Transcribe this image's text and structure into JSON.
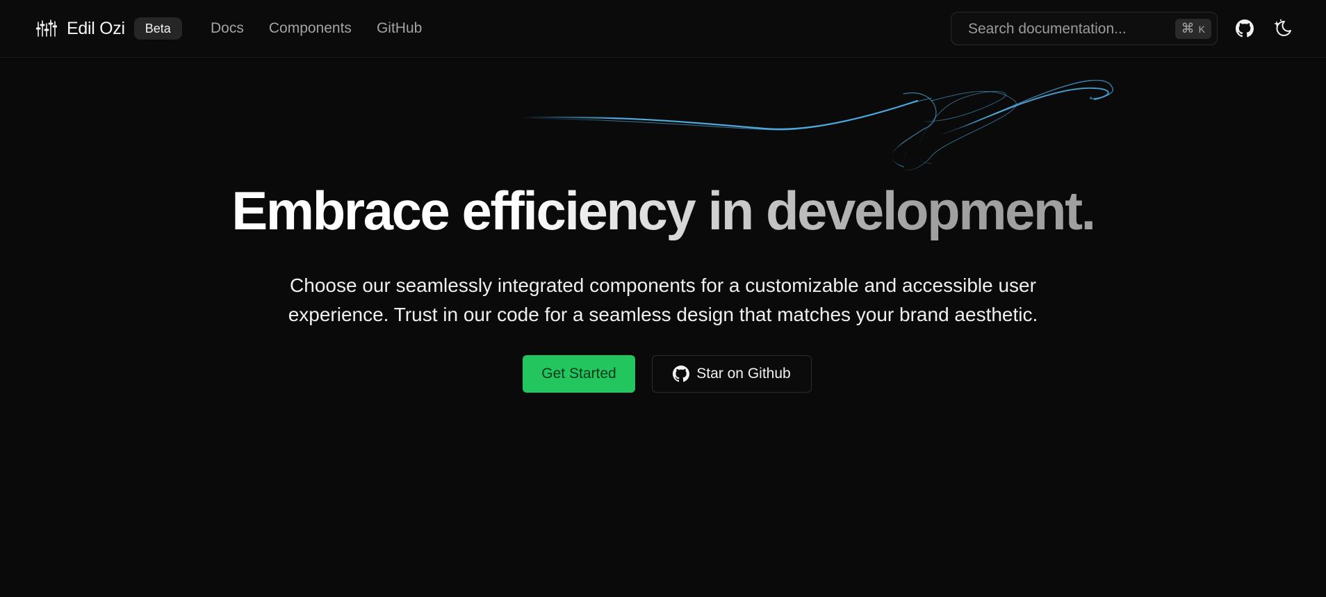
{
  "header": {
    "brand_name": "Edil Ozi",
    "badge": "Beta",
    "nav": [
      {
        "label": "Docs"
      },
      {
        "label": "Components"
      },
      {
        "label": "GitHub"
      }
    ],
    "search": {
      "placeholder": "Search documentation...",
      "shortcut_symbol": "⌘",
      "shortcut_key": "K"
    },
    "icons": {
      "logo": "equalizer-logo-icon",
      "github": "github-icon",
      "theme": "moon-stars-icon"
    }
  },
  "hero": {
    "title": "Embrace efficiency in development.",
    "subtitle_line1": "Choose our seamlessly integrated components for a customizable and accessible user",
    "subtitle_line2": "experience. Trust in our code for a seamless design that matches your brand aesthetic.",
    "primary_cta": "Get Started",
    "secondary_cta": "Star on Github"
  },
  "colors": {
    "background": "#0a0a0a",
    "accent": "#22c55e",
    "swirl": "#4fb3f0"
  }
}
